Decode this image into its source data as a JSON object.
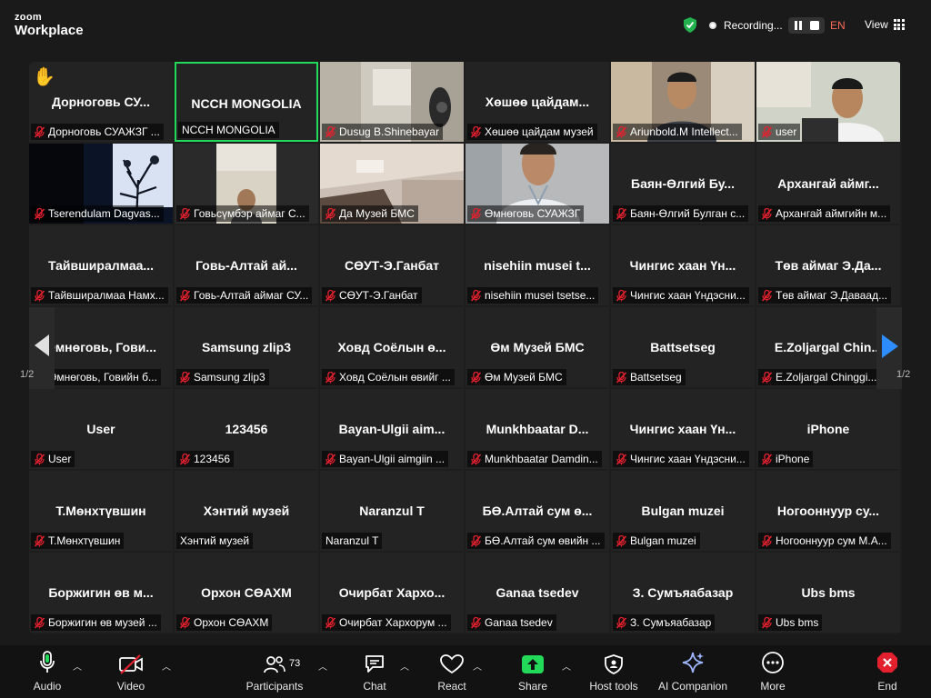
{
  "app": {
    "brand_top": "zoom",
    "brand_bottom": "Workplace"
  },
  "header": {
    "recording_label": "Recording...",
    "language": "EN",
    "view_label": "View"
  },
  "gallery": {
    "page_indicator_left": "1/2",
    "page_indicator_right": "1/2",
    "tiles": [
      {
        "name": "Дорноговь СУ...",
        "label": "Дорноговь СУАЖЗГ ...",
        "muted": true,
        "hand": true
      },
      {
        "name": "NCCH MONGOLIA",
        "label": "NCCH MONGOLIA",
        "muted": false,
        "active": true
      },
      {
        "name": "",
        "label": "Dusug B.Shinebayar",
        "muted": true,
        "video": "room"
      },
      {
        "name": "Хөшөө цайдам...",
        "label": "Хөшөө цайдам музей",
        "muted": true
      },
      {
        "name": "",
        "label": "Ariunbold.M Intellect...",
        "muted": true,
        "video": "man1"
      },
      {
        "name": "",
        "label": "user",
        "muted": true,
        "video": "man2"
      },
      {
        "name": "",
        "label": "Tserendulam Dagvas...",
        "muted": true,
        "video": "tree"
      },
      {
        "name": "",
        "label": "Говьсүмбэр аймаг С...",
        "muted": true,
        "video": "office"
      },
      {
        "name": "",
        "label": "Да Музей БМС",
        "muted": true,
        "video": "ceiling"
      },
      {
        "name": "",
        "label": "Өмнөговь СУАЖЗГ",
        "muted": true,
        "video": "woman"
      },
      {
        "name": "Баян-Өлгий Бу...",
        "label": "Баян-Өлгий Булган с...",
        "muted": true
      },
      {
        "name": "Архангай аймг...",
        "label": "Архангай аймгийн м...",
        "muted": true
      },
      {
        "name": "Тайвширалмаа...",
        "label": "Тайвширалмаа Намх...",
        "muted": true
      },
      {
        "name": "Говь-Алтай ай...",
        "label": "Говь-Алтай аймаг СУ...",
        "muted": true
      },
      {
        "name": "СӨУТ-Э.Ганбат",
        "label": "СӨУТ-Э.Ганбат",
        "muted": true
      },
      {
        "name": "nisehiin musei t...",
        "label": "nisehiin musei tsetse...",
        "muted": true
      },
      {
        "name": "Чингис хаан Үн...",
        "label": "Чингис хаан Үндэсни...",
        "muted": true
      },
      {
        "name": "Төв аймаг Э.Да...",
        "label": "Төв аймаг Э.Даваад...",
        "muted": true
      },
      {
        "name": "Өмнөговь, Гови...",
        "label": "Өмнөговь, Говийн б...",
        "muted": true
      },
      {
        "name": "Samsung zlip3",
        "label": "Samsung zlip3",
        "muted": true
      },
      {
        "name": "Ховд Соёлын ө...",
        "label": "Ховд Соёлын өвийг ...",
        "muted": true
      },
      {
        "name": "Өм Музей БМС",
        "label": "Өм Музей БМС",
        "muted": true
      },
      {
        "name": "Battsetseg",
        "label": "Battsetseg",
        "muted": true
      },
      {
        "name": "E.Zoljargal Chin...",
        "label": "E.Zoljargal Chinggi...",
        "muted": true
      },
      {
        "name": "User",
        "label": "User",
        "muted": true
      },
      {
        "name": "123456",
        "label": "123456",
        "muted": true
      },
      {
        "name": "Bayan-Ulgii aim...",
        "label": "Bayan-Ulgii aimgiin ...",
        "muted": true
      },
      {
        "name": "Munkhbaatar D...",
        "label": "Munkhbaatar Damdin...",
        "muted": true
      },
      {
        "name": "Чингис хаан Үн...",
        "label": "Чингис хаан Үндэсни...",
        "muted": true
      },
      {
        "name": "iPhone",
        "label": "iPhone",
        "muted": true
      },
      {
        "name": "Т.Мөнхтүвшин",
        "label": "Т.Мөнхтүвшин",
        "muted": true
      },
      {
        "name": "Хэнтий музей",
        "label": "Хэнтий музей",
        "muted": false
      },
      {
        "name": "Naranzul T",
        "label": "Naranzul T",
        "muted": false
      },
      {
        "name": "БӨ.Алтай сум ө...",
        "label": "БӨ.Алтай сум өвийн ...",
        "muted": true
      },
      {
        "name": "Bulgan muzei",
        "label": "Bulgan muzei",
        "muted": true
      },
      {
        "name": "Ногооннуур су...",
        "label": "Ногооннуур сум М.А...",
        "muted": true
      },
      {
        "name": "Боржигин өв м...",
        "label": "Боржигин өв музей ...",
        "muted": true
      },
      {
        "name": "Орхон СӨАХМ",
        "label": "Орхон СӨАХМ",
        "muted": true
      },
      {
        "name": "Очирбат Хархо...",
        "label": "Очирбат Хархорум ...",
        "muted": true
      },
      {
        "name": "Ganaa tsedev",
        "label": "Ganaa tsedev",
        "muted": true
      },
      {
        "name": "З. Сумъяабазар",
        "label": "З. Сумъяабазар",
        "muted": true
      },
      {
        "name": "Ubs bms",
        "label": "Ubs bms",
        "muted": true
      }
    ]
  },
  "toolbar": {
    "audio": "Audio",
    "video": "Video",
    "participants": "Participants",
    "participant_count": "73",
    "chat": "Chat",
    "react": "React",
    "share": "Share",
    "host_tools": "Host tools",
    "ai_companion": "AI Companion",
    "more": "More",
    "end": "End"
  },
  "colors": {
    "active_border": "#23d959",
    "share_green": "#23d959",
    "end_red": "#e5202e",
    "mute_red": "#e5202e"
  }
}
